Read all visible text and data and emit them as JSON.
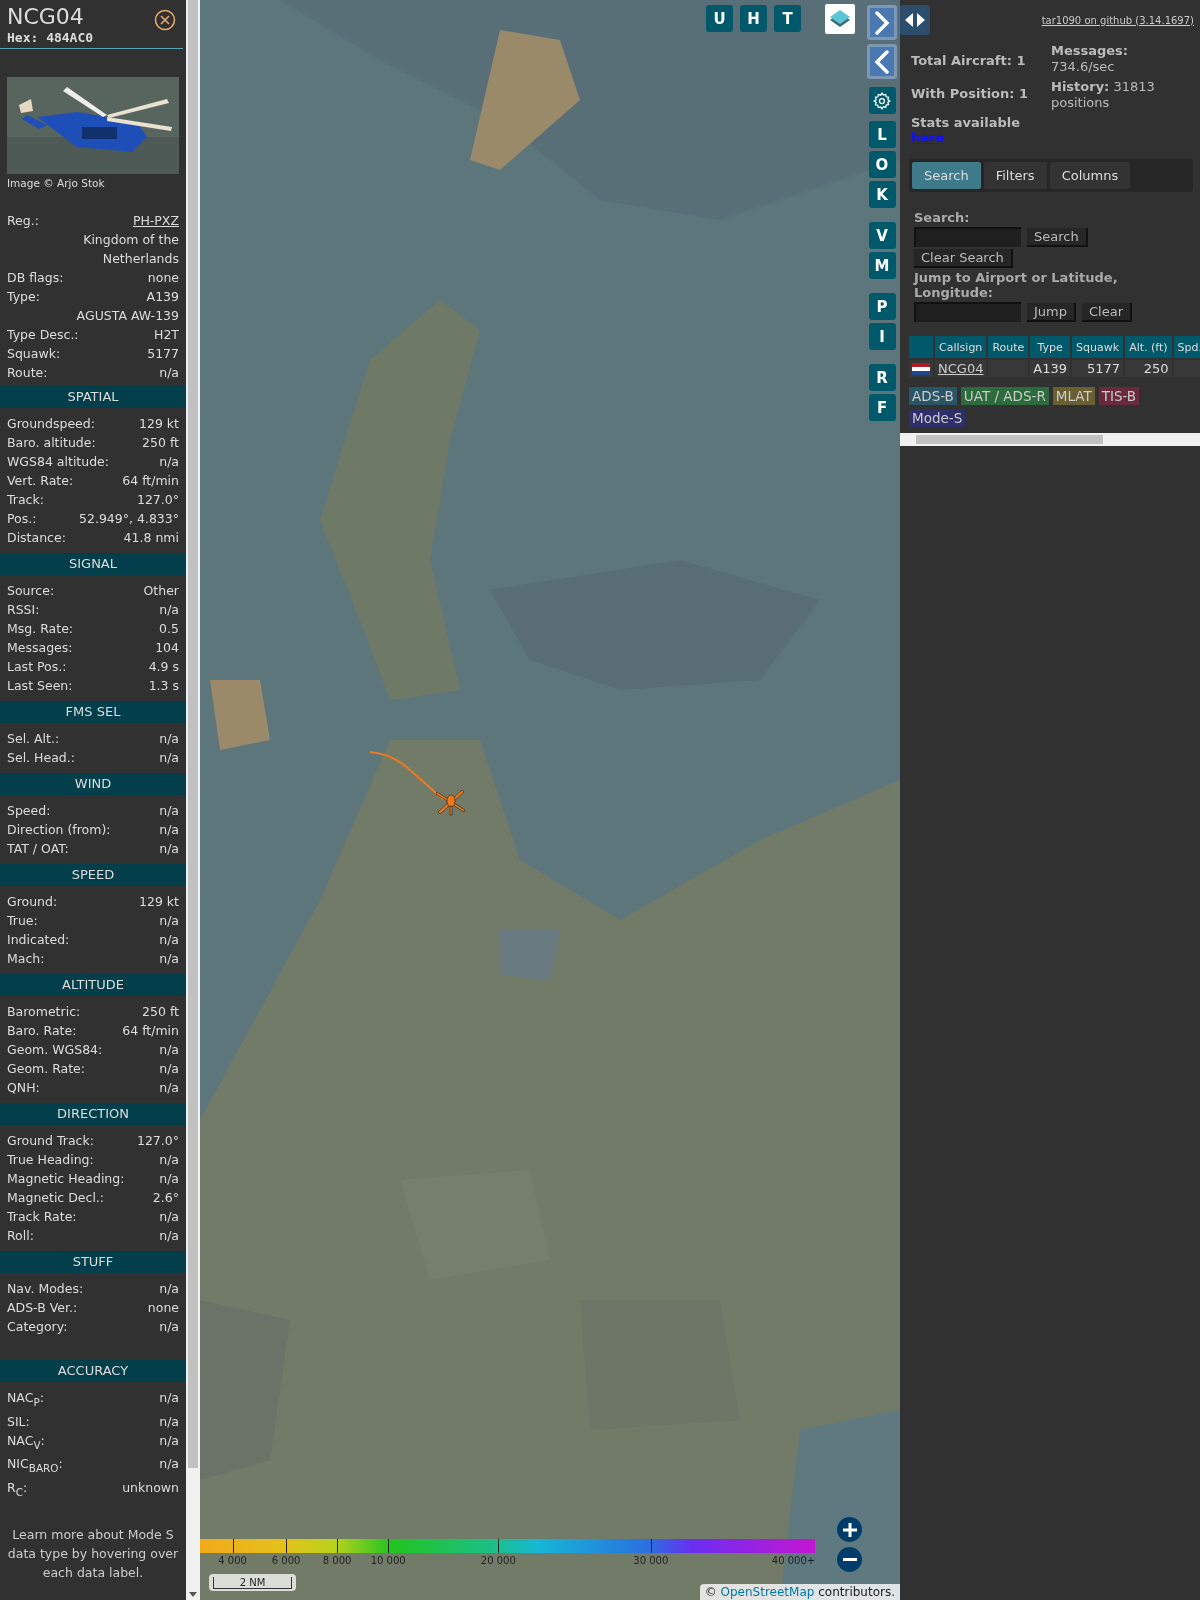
{
  "aircraft": {
    "callsign": "NCG04",
    "hex": "Hex: 484AC0"
  },
  "photo": {
    "kind": "picture",
    "credit": "Image © Arjo Stok"
  },
  "info_rows": [
    {
      "kind": "link",
      "label": "Reg.:",
      "value": "PH-PXZ"
    },
    {
      "kind": "value",
      "value": "Kingdom of the Netherlands"
    },
    {
      "kind": "pair",
      "label": "DB flags:",
      "value": "none"
    },
    {
      "kind": "pair",
      "label": "Type:",
      "value": "A139"
    },
    {
      "kind": "value",
      "value": "AGUSTA AW-139"
    },
    {
      "kind": "pair",
      "label": "Type Desc.:",
      "value": "H2T"
    },
    {
      "kind": "pair",
      "label": "Squawk:",
      "value": "5177"
    },
    {
      "kind": "pair",
      "label": "Route:",
      "value": "n/a"
    }
  ],
  "sections": [
    {
      "title": "SPATIAL",
      "rows": [
        {
          "label": "Groundspeed:",
          "value": "129 kt"
        },
        {
          "label": "Baro. altitude:",
          "value": "250 ft"
        },
        {
          "label": "WGS84 altitude:",
          "value": "n/a"
        },
        {
          "label": "Vert. Rate:",
          "value": "64 ft/min"
        },
        {
          "label": "Track:",
          "value": "127.0°"
        },
        {
          "label": "Pos.:",
          "value": "52.949°, 4.833°"
        },
        {
          "label": "Distance:",
          "value": "41.8 nmi"
        }
      ]
    },
    {
      "title": "SIGNAL",
      "rows": [
        {
          "label": "Source:",
          "value": "Other"
        },
        {
          "label": "RSSI:",
          "value": "n/a"
        },
        {
          "label": "Msg. Rate:",
          "value": "0.5"
        },
        {
          "label": "Messages:",
          "value": "104"
        },
        {
          "label": "Last Pos.:",
          "value": "4.9 s"
        },
        {
          "label": "Last Seen:",
          "value": "1.3 s"
        }
      ]
    },
    {
      "title": "FMS SEL",
      "rows": [
        {
          "label": "Sel. Alt.:",
          "value": "n/a"
        },
        {
          "label": "Sel. Head.:",
          "value": "n/a"
        }
      ]
    },
    {
      "title": "WIND",
      "rows": [
        {
          "label": "Speed:",
          "value": "n/a"
        },
        {
          "label": "Direction (from):",
          "value": "n/a"
        },
        {
          "label": "TAT / OAT:",
          "value": "n/a"
        }
      ]
    },
    {
      "title": "SPEED",
      "rows": [
        {
          "label": "Ground:",
          "value": "129 kt"
        },
        {
          "label": "True:",
          "value": "n/a"
        },
        {
          "label": "Indicated:",
          "value": "n/a"
        },
        {
          "label": "Mach:",
          "value": "n/a"
        }
      ]
    },
    {
      "title": "ALTITUDE",
      "rows": [
        {
          "label": "Barometric:",
          "value": "250 ft"
        },
        {
          "label": "Baro. Rate:",
          "value": "64 ft/min"
        },
        {
          "label": "Geom. WGS84:",
          "value": "n/a"
        },
        {
          "label": "Geom. Rate:",
          "value": "n/a"
        },
        {
          "label": "QNH:",
          "value": "n/a"
        }
      ]
    },
    {
      "title": "DIRECTION",
      "rows": [
        {
          "label": "Ground Track:",
          "value": "127.0°"
        },
        {
          "label": "True Heading:",
          "value": "n/a"
        },
        {
          "label": "Magnetic Heading:",
          "value": "n/a"
        },
        {
          "label": "Magnetic Decl.:",
          "value": "2.6°"
        },
        {
          "label": "Track Rate:",
          "value": "n/a"
        },
        {
          "label": "Roll:",
          "value": "n/a"
        }
      ]
    },
    {
      "title": "STUFF",
      "rows": [
        {
          "label": "Nav. Modes:",
          "value": "n/a"
        },
        {
          "label": "ADS-B Ver.:",
          "value": "none"
        },
        {
          "label": "Category:",
          "value": "n/a"
        }
      ]
    },
    {
      "title": "ACCURACY",
      "rows": [
        {
          "label": "NAC$_{P}$:",
          "value": "n/a"
        },
        {
          "label": "SIL:",
          "value": "n/a"
        },
        {
          "label": "NAC$_{V}$:",
          "value": "n/a"
        },
        {
          "label": "NIC$_{BARO}$:",
          "value": "n/a"
        },
        {
          "label": "R$_{C}$:",
          "value": "unknown"
        }
      ]
    }
  ],
  "note": "Learn more about Mode S data type by hovering over each data label.",
  "map": {
    "top_buttons": [
      "U",
      "H",
      "T"
    ],
    "side_groups": [
      [
        "L",
        "O",
        "K"
      ],
      [
        "V",
        "M"
      ],
      [
        "P",
        "I"
      ],
      [
        "R",
        "F"
      ]
    ],
    "legend": [
      "4 000",
      "6 000",
      "8 000",
      "10 000",
      "20 000",
      "30 000",
      "40 000+"
    ],
    "scale": "2 NM",
    "attribution": {
      "prefix": "©",
      "link": "OpenStreetMap",
      "suffix": "contributors."
    }
  },
  "panel": {
    "github_link": "tar1090 on github (3.14.1697)",
    "total_aircraft": "Total Aircraft: 1",
    "with_position": "With Position: 1",
    "stats_text": "Stats available",
    "stats_link": "here",
    "messages": "**Messages:** 734.6/sec",
    "history": "**History:** 31813 positions",
    "tabs": [
      {
        "label": "Search",
        "selected": true
      },
      {
        "label": "Filters",
        "selected": false
      },
      {
        "label": "Columns",
        "selected": false
      }
    ],
    "search_label": "Search:",
    "search_button": "Search",
    "clear_search_button": "Clear Search",
    "jump_label": "Jump to Airport or Latitude, Longitude:",
    "jump_button": "Jump",
    "clear_button": "Clear",
    "columns": [
      "Callsign",
      "Route",
      "Type",
      "Squawk",
      "Alt. (ft)",
      "Spd."
    ],
    "rows": [
      {
        "callsign": "NCG04",
        "type": "A139",
        "squawk": "5177",
        "altitude": "250"
      }
    ],
    "sources": [
      {
        "label": "ADS-B",
        "color": "#2a5566"
      },
      {
        "label": "UAT / ADS-R",
        "color": "#2d6a3c"
      },
      {
        "label": "MLAT",
        "color": "#6a5f32"
      },
      {
        "label": "TIS-B",
        "color": "#6a2a3e"
      },
      {
        "label": "Mode-S",
        "color": "#2e2e6a"
      }
    ]
  }
}
